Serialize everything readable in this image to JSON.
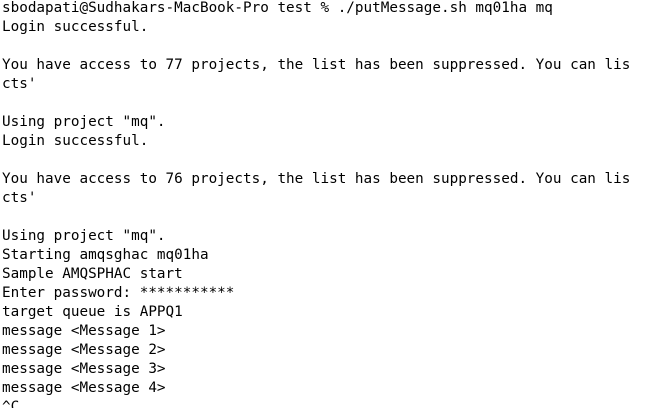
{
  "terminal": {
    "lines": [
      "sbodapati@Sudhakars-MacBook-Pro test % ./putMessage.sh mq01ha mq",
      "Login successful.",
      "",
      "You have access to 77 projects, the list has been suppressed. You can lis",
      "cts'",
      "",
      "Using project \"mq\".",
      "Login successful.",
      "",
      "You have access to 76 projects, the list has been suppressed. You can lis",
      "cts'",
      "",
      "Using project \"mq\".",
      "Starting amqsghac mq01ha",
      "Sample AMQSPHAC start",
      "Enter password: ***********",
      "target queue is APPQ1",
      "message <Message 1>",
      "message <Message 2>",
      "message <Message 3>",
      "message <Message 4>",
      "^C"
    ]
  }
}
